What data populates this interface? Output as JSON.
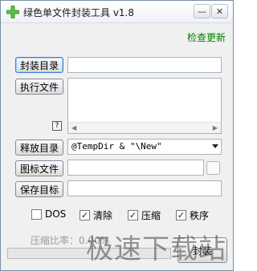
{
  "window": {
    "title": "绿色单文件封装工具 v1.8",
    "minimize_label": "—",
    "close_label": "✕"
  },
  "links": {
    "check_update": "检查更新"
  },
  "buttons": {
    "package_dir": "封装目录",
    "exec_file": "执行文件",
    "release_dir": "释放目录",
    "icon_file": "图标文件",
    "save_target": "保存目标",
    "help": "?",
    "pack": "封装"
  },
  "fields": {
    "package_dir_value": "",
    "exec_file_value": "",
    "release_dir_value": "@TempDir & \"\\New\"",
    "icon_file_value": "",
    "save_target_value": ""
  },
  "checkboxes": [
    {
      "label": "DOS",
      "checked": false
    },
    {
      "label": "清除",
      "checked": true
    },
    {
      "label": "压缩",
      "checked": true
    },
    {
      "label": "秩序",
      "checked": true
    }
  ],
  "status": {
    "ratio_label": "压缩比率：",
    "ratio_value": "0.00%",
    "progress": 0
  },
  "watermark": "极速下载站",
  "colors": {
    "link": "#008000",
    "icon_green": "#3c9a2a"
  },
  "icons": {
    "app": "green-plus-icon",
    "dropdown": "chevron-down-icon"
  }
}
